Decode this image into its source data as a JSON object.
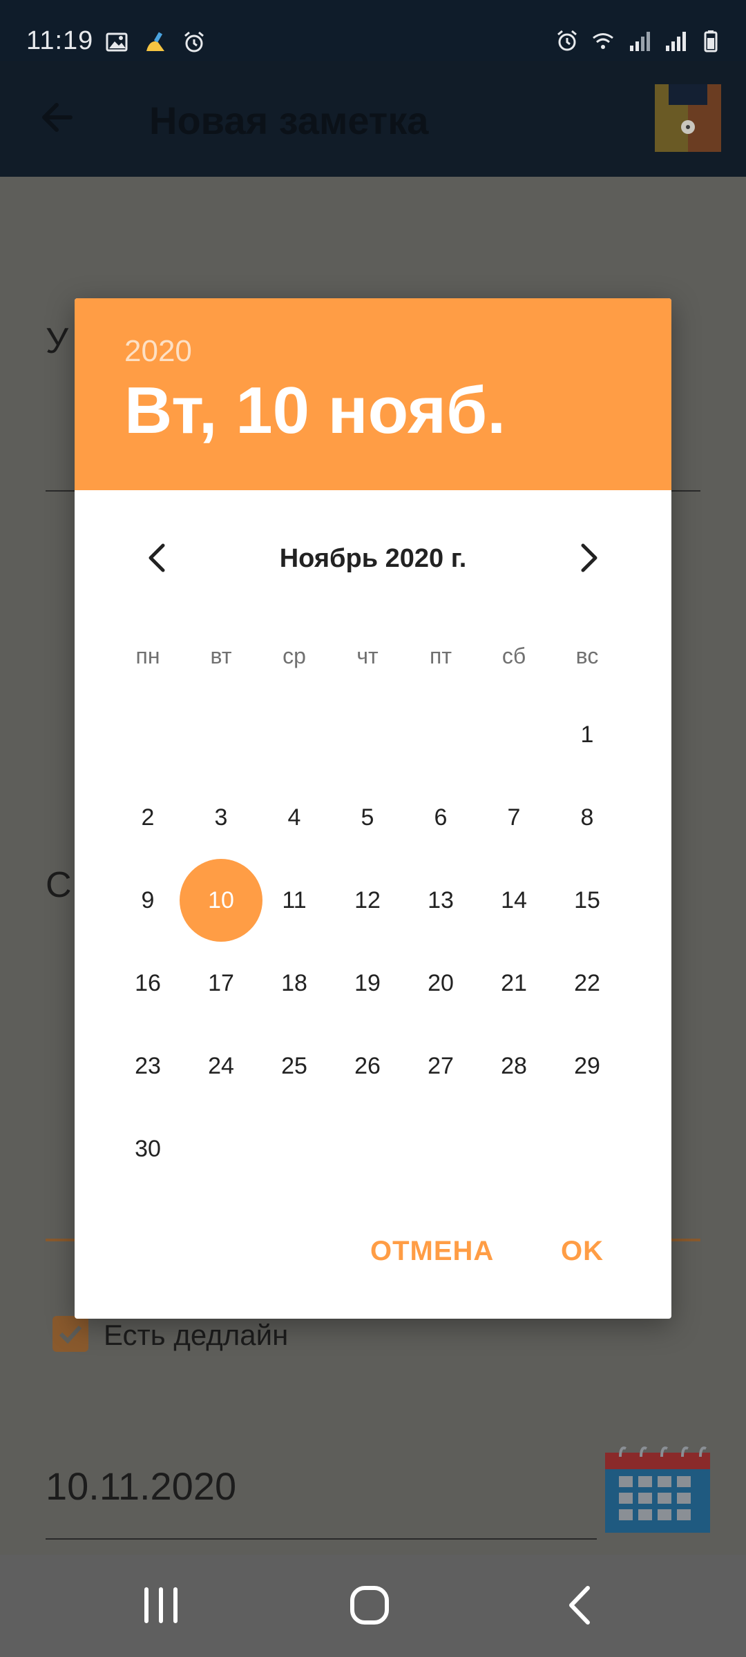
{
  "status_bar": {
    "time": "11:19",
    "left_icons": [
      "image-icon",
      "cleaner-icon",
      "alarm-icon"
    ],
    "right_icons": [
      "alarm-icon",
      "wifi-icon",
      "signal-icon",
      "signal-icon",
      "battery-icon"
    ]
  },
  "app_bar": {
    "title": "Новая заметка",
    "back_icon": "arrow-left-icon",
    "save_icon": "floppy-save-icon"
  },
  "form": {
    "field1_partial": "У",
    "field2_partial": "С",
    "deadline_checkbox_label": "Есть дедлайн",
    "deadline_checked": true,
    "deadline_date": "10.11.2020",
    "calendar_icon": "calendar-icon"
  },
  "date_picker": {
    "header_year": "2020",
    "header_date": "Вт, 10 нояб.",
    "month_label": "Ноябрь 2020 г.",
    "weekdays": [
      "пн",
      "вт",
      "ср",
      "чт",
      "пт",
      "сб",
      "вс"
    ],
    "weeks": [
      [
        "",
        "",
        "",
        "",
        "",
        "",
        "1"
      ],
      [
        "2",
        "3",
        "4",
        "5",
        "6",
        "7",
        "8"
      ],
      [
        "9",
        "10",
        "11",
        "12",
        "13",
        "14",
        "15"
      ],
      [
        "16",
        "17",
        "18",
        "19",
        "20",
        "21",
        "22"
      ],
      [
        "23",
        "24",
        "25",
        "26",
        "27",
        "28",
        "29"
      ],
      [
        "30",
        "",
        "",
        "",
        "",
        "",
        ""
      ]
    ],
    "selected_day": "10",
    "cancel_label": "ОТМЕНА",
    "ok_label": "OK",
    "accent_color": "#ff9d45"
  },
  "nav_bar": {
    "buttons": [
      "recents-icon",
      "home-icon",
      "back-icon"
    ]
  }
}
